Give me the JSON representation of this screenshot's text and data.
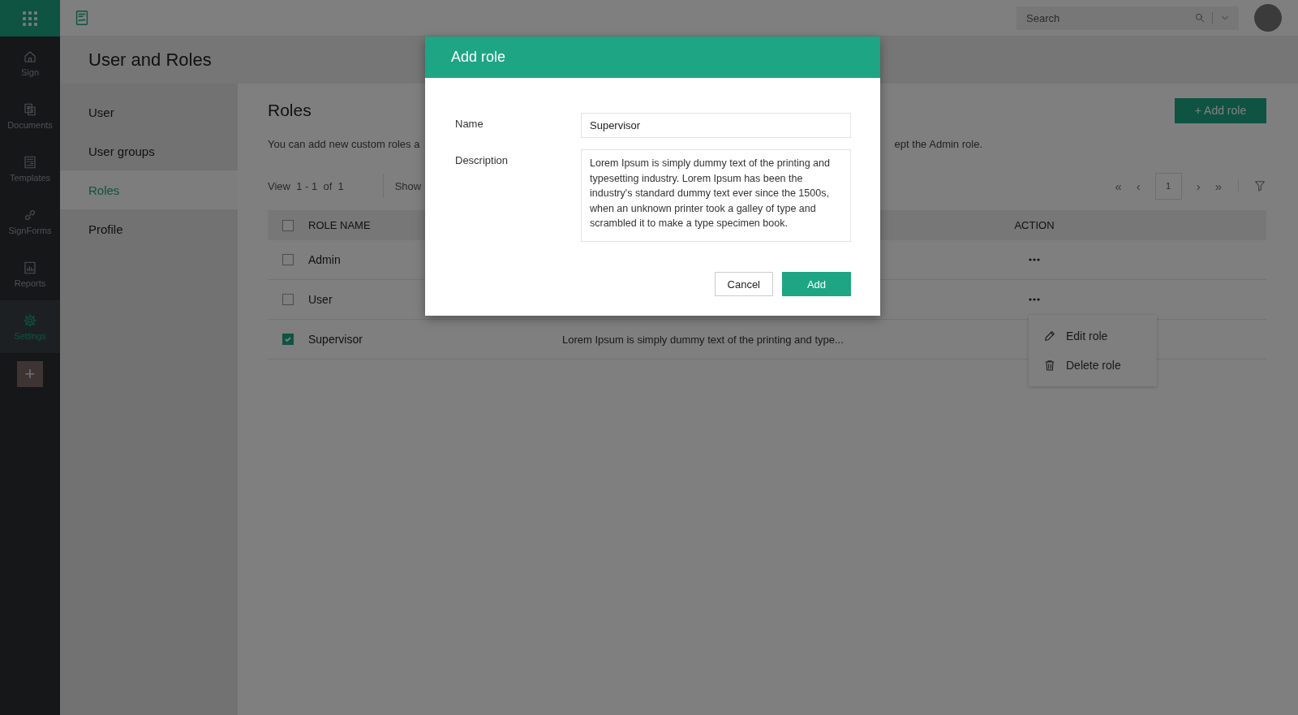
{
  "rail": {
    "items": [
      {
        "label": "Sign",
        "selected": false
      },
      {
        "label": "Documents",
        "selected": false
      },
      {
        "label": "Templates",
        "selected": false
      },
      {
        "label": "SignForms",
        "selected": false
      },
      {
        "label": "Reports",
        "selected": false
      },
      {
        "label": "Settings",
        "selected": true
      }
    ],
    "add_button": "+"
  },
  "topbar": {
    "search": {
      "placeholder": "Search"
    }
  },
  "page_title": "User and Roles",
  "submenu": [
    {
      "label": "User",
      "selected": false
    },
    {
      "label": "User groups",
      "selected": false
    },
    {
      "label": "Roles",
      "selected": true
    },
    {
      "label": "Profile",
      "selected": false
    }
  ],
  "roles": {
    "title": "Roles",
    "add_button": "+ Add role",
    "intro_start": "You can add new custom roles a",
    "intro_end": "ept the Admin role.",
    "view_count": "View  1 - 1  of  1",
    "show_label": "Show",
    "pager": {
      "first": "«",
      "prev": "‹",
      "page": "1",
      "next": "›",
      "last": "»"
    }
  },
  "table": {
    "columns": [
      {
        "label": "ROLE NAME"
      },
      {
        "label": "ACTION"
      }
    ],
    "header_checked": false,
    "rows": [
      {
        "name": "Admin",
        "checked": false
      },
      {
        "name": "User",
        "checked": false
      },
      {
        "name": "Supervisor",
        "description": "Lorem Ipsum is simply dummy text of the printing and type...",
        "checked": true
      }
    ]
  },
  "row_menu": {
    "items": [
      {
        "label": "Edit role"
      },
      {
        "label": "Delete role"
      }
    ]
  },
  "dialog": {
    "title": "Add role",
    "name_label": "Name",
    "name_value": "Supervisor",
    "description_label": "Description",
    "description_value": "Lorem Ipsum is simply dummy text of the printing and typesetting industry. Lorem Ipsum has been the industry's standard dummy text ever since the 1500s, when an unknown printer took a galley of type and scrambled it to make a type specimen book.",
    "buttons": [
      {
        "label": "Cancel",
        "kind": "secondary"
      },
      {
        "label": "Add",
        "kind": "primary"
      }
    ]
  }
}
